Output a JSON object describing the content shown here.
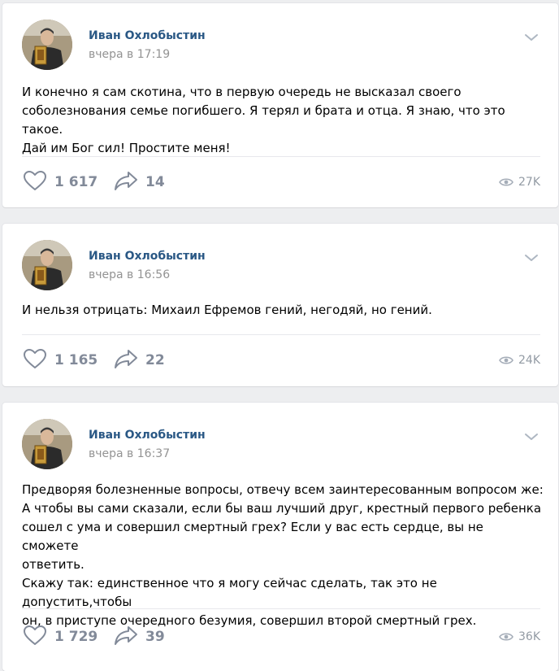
{
  "posts": [
    {
      "author": "Иван Охлобыстин",
      "time": "вчера в 17:19",
      "text": "И конечно я сам скотина, что в первую очередь не высказал своего\nсоболезнования семье погибшего. Я терял и брата и отца. Я знаю, что это такое.\nДай им Бог сил! Простите меня!",
      "likes": "1 617",
      "shares": "14",
      "views": "27K"
    },
    {
      "author": "Иван Охлобыстин",
      "time": "вчера в 16:56",
      "text": "И нельзя отрицать: Михаил Ефремов гений, негодяй, но гений.",
      "likes": "1 165",
      "shares": "22",
      "views": "24K"
    },
    {
      "author": "Иван Охлобыстин",
      "time": "вчера в 16:37",
      "text": "Предворяя болезненные вопросы, отвечу всем заинтересованным вопросом же:\nА чтобы вы сами сказали, если бы ваш лучший друг, крестный первого ребенка\nсошел с ума и совершил смертный грех? Если у вас есть сердце, вы не сможете\nответить.\nСкажу так: единственное что я могу сейчас сделать, так это не допустить,чтобы\nон, в приступе очередного безумия, совершил второй смертный грех.",
      "likes": "1 729",
      "shares": "39",
      "views": "36K"
    }
  ],
  "icons": {
    "menu": "chevron-down-icon",
    "like": "heart-icon",
    "share": "share-arrow-icon",
    "views": "eye-icon"
  },
  "colors": {
    "author_link": "#2a5885",
    "muted_text": "#939393",
    "action_gray": "#828a99",
    "background": "#edeef0"
  }
}
